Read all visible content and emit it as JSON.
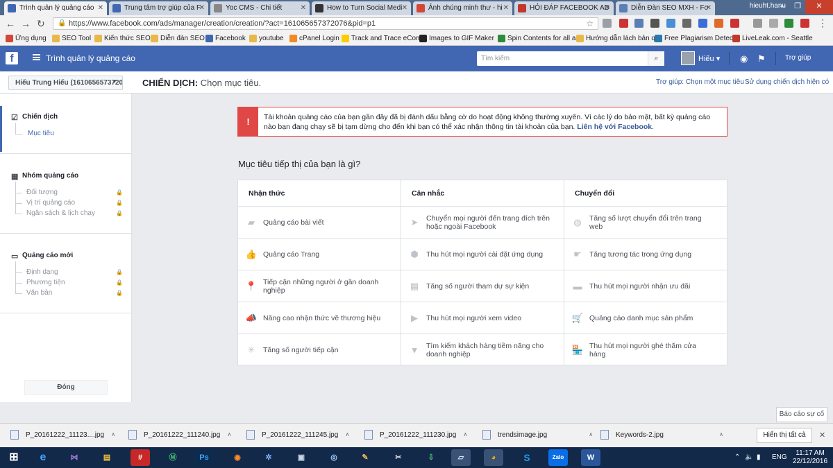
{
  "browser": {
    "tabs": [
      {
        "title": "Trình quản lý quảng cáo",
        "color": "#4267b2",
        "active": true
      },
      {
        "title": "Trung tâm trợ giúp của F",
        "color": "#4267b2"
      },
      {
        "title": "Yoc CMS - Chi tiết",
        "color": "#888888"
      },
      {
        "title": "How to Turn Social Medi",
        "color": "#333333"
      },
      {
        "title": "Ảnh chúng minh thư - hi",
        "color": "#d44638"
      },
      {
        "title": "HỎI ĐÁP FACEBOOK AD",
        "color": "#c0392b"
      },
      {
        "title": "Diễn Đàn SEO MXH - Fo",
        "color": "#5b7fb5"
      }
    ],
    "window_user": "hieuht.hanu",
    "window_controls": [
      "–",
      "❐",
      "✕"
    ],
    "nav_icons": [
      "back-arrow",
      "forward-arrow",
      "reload"
    ],
    "url": "https://www.facebook.com/ads/manager/creation/creation/?act=161065657372076&pid=p1",
    "bookmarks": [
      {
        "label": "Ứng dụng",
        "color": "#d44638"
      },
      {
        "label": "SEO Tool",
        "color": "#e8b84a"
      },
      {
        "label": "Kiến thức SEO",
        "color": "#e8b84a"
      },
      {
        "label": "Diễn đàn SEO",
        "color": "#e8b84a"
      },
      {
        "label": "Facebook",
        "color": "#4267b2"
      },
      {
        "label": "youtube",
        "color": "#e8b84a"
      },
      {
        "label": "cPanel Login",
        "color": "#f08a24"
      },
      {
        "label": "Track and Trace eCom",
        "color": "#ffcc00"
      },
      {
        "label": "Images to GIF Maker",
        "color": "#222222"
      },
      {
        "label": "Spin Contents for all a",
        "color": "#2e8b3a"
      },
      {
        "label": "Hướng dẫn lách bản q",
        "color": "#e8b84a"
      },
      {
        "label": "Free Plagiarism Detec",
        "color": "#2a7ab0"
      },
      {
        "label": "LiveLeak.com - Seattle",
        "color": "#c0392b"
      }
    ]
  },
  "fb": {
    "logo": "f",
    "app_title": "Trình quản lý quảng cáo",
    "search_placeholder": "Tìm kiếm",
    "user_name": "Hiếu",
    "help": "Trợ giúp"
  },
  "subheader": {
    "account": "Hiếu Trung Hiếu (161065657372076)",
    "crumb_bold": "CHIẾN DỊCH:",
    "crumb_rest": "Chọn mục tiêu.",
    "link_help": "Trợ giúp: Chọn một mục tiêu",
    "link_existing": "Sử dụng chiến dịch hiện có"
  },
  "sidebar": {
    "campaign": {
      "title": "Chiến dịch",
      "items": [
        "Mục tiêu"
      ]
    },
    "adset": {
      "title": "Nhóm quảng cáo",
      "items": [
        "Đối tượng",
        "Vị trí quảng cáo",
        "Ngân sách & lịch chạy"
      ]
    },
    "ad": {
      "title": "Quảng cáo mới",
      "items": [
        "Định dạng",
        "Phương tiện",
        "Văn bản"
      ]
    },
    "close": "Đóng"
  },
  "alert": {
    "text": "Tài khoản quảng cáo của bạn gần đây đã bị đánh dấu bằng cờ do hoạt động không thường xuyên. Vì các lý do bảo mật, bất kỳ quảng cáo nào bạn đang chạy sẽ bị tạm dừng cho đến khi bạn có thể xác nhận thông tin tài khoản của bạn.",
    "link": "Liên hệ với Facebook",
    "tail": "."
  },
  "question": "Mục tiêu tiếp thị của bạn là gì?",
  "objectives": {
    "columns": [
      {
        "header": "Nhận thức",
        "items": [
          {
            "icon": "post-icon",
            "label": "Quảng cáo bài viết"
          },
          {
            "icon": "like-icon",
            "label": "Quảng cáo Trang"
          },
          {
            "icon": "location-pin-icon",
            "label": "Tiếp cận những người ở gần doanh nghiệp"
          },
          {
            "icon": "megaphone-icon",
            "label": "Nâng cao nhận thức về thương hiệu"
          },
          {
            "icon": "reach-icon",
            "label": "Tăng số người tiếp cận"
          }
        ]
      },
      {
        "header": "Cân nhắc",
        "items": [
          {
            "icon": "cursor-icon",
            "label": "Chuyển mọi người đến trang đích trên hoặc ngoài Facebook"
          },
          {
            "icon": "app-box-icon",
            "label": "Thu hút mọi người cài đặt ứng dụng"
          },
          {
            "icon": "calendar-icon",
            "label": "Tăng số người tham dự sự kiện"
          },
          {
            "icon": "video-camera-icon",
            "label": "Thu hút mọi người xem video"
          },
          {
            "icon": "funnel-icon",
            "label": "Tìm kiếm khách hàng tiềm năng cho doanh nghiệp"
          }
        ]
      },
      {
        "header": "Chuyển đổi",
        "items": [
          {
            "icon": "globe-icon",
            "label": "Tăng số lượt chuyển đổi trên trang web"
          },
          {
            "icon": "app-engagement-icon",
            "label": "Tăng tương tác trong ứng dụng"
          },
          {
            "icon": "offer-icon",
            "label": "Thu hút mọi người nhận ưu đãi"
          },
          {
            "icon": "cart-icon",
            "label": "Quảng cáo danh mục sản phẩm"
          },
          {
            "icon": "store-icon",
            "label": "Thu hút mọi người ghé thăm cửa hàng"
          }
        ]
      }
    ]
  },
  "report": "Báo cáo sự cố",
  "downloads": {
    "files": [
      "P_20161222_11123....jpg",
      "P_20161222_111240.jpg",
      "P_20161222_111245.jpg",
      "P_20161222_111230.jpg",
      "trendsimage.jpg",
      "Keywords-2.jpg"
    ],
    "show_all": "Hiển thị tất cả"
  },
  "taskbar": {
    "lang": "ENG",
    "time": "11:17 AM",
    "date": "22/12/2016"
  }
}
